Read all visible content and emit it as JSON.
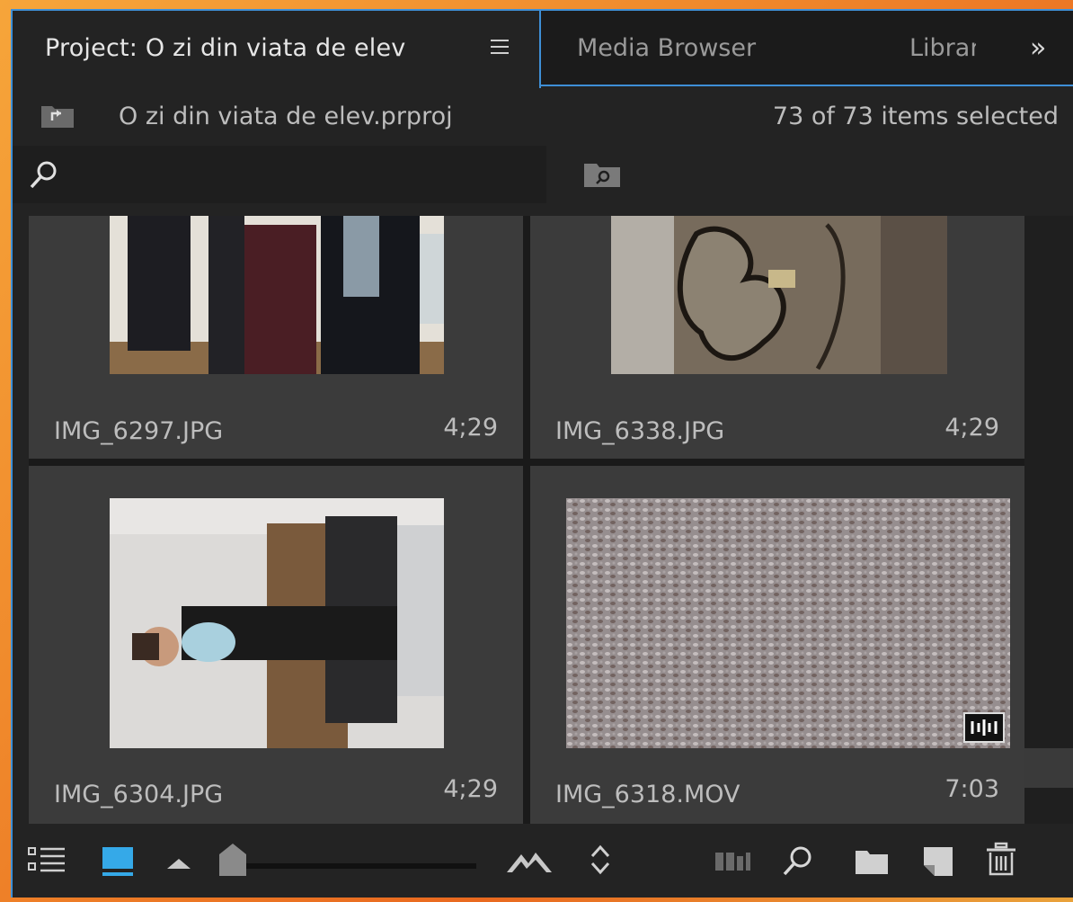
{
  "tabs": {
    "project": "Project: O zi din viata de elev",
    "media_browser": "Media Browser",
    "libraries": "Libraries",
    "overflow": "»"
  },
  "header": {
    "project_file": "O zi din viata de elev.prproj",
    "selection_count": "73 of 73 items selected"
  },
  "search": {
    "value": "",
    "placeholder": ""
  },
  "clips": [
    {
      "name": "IMG_6297.JPG",
      "duration": "4;29"
    },
    {
      "name": "IMG_6338.JPG",
      "duration": "4;29"
    },
    {
      "name": "IMG_6304.JPG",
      "duration": "4;29"
    },
    {
      "name": "IMG_6318.MOV",
      "duration": "7:03"
    }
  ],
  "colors": {
    "accent": "#3e8fd6",
    "panel": "#232323",
    "cell": "#3b3b3b",
    "text": "#bdbdbd"
  },
  "icons": {
    "list_view": "list-view-icon",
    "icon_view": "icon-view-icon",
    "zoom_out": "small-mountain-icon",
    "zoom_in": "large-mountain-icon",
    "sort": "sort-icon",
    "automate": "automate-to-sequence-icon",
    "find": "find-icon",
    "new_bin": "new-bin-icon",
    "new_item": "new-item-icon",
    "clear": "trash-icon"
  },
  "zoom": {
    "level": 0.0
  }
}
